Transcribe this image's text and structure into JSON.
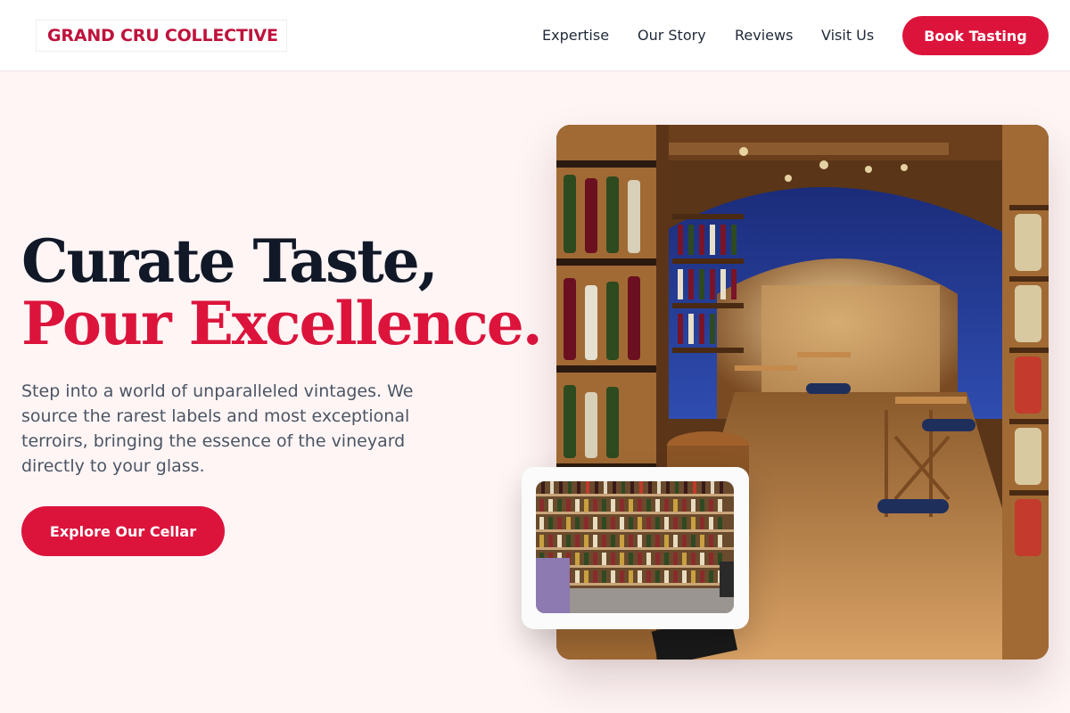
{
  "header": {
    "logo": "GRAND CRU COLLECTIVE",
    "nav": [
      "Expertise",
      "Our Story",
      "Reviews",
      "Visit Us"
    ],
    "book_button": "Book Tasting"
  },
  "hero": {
    "headline_line1": "Curate Taste,",
    "headline_line2": "Pour Excellence.",
    "description": "Step into a world of unparalleled vintages. We source the rarest labels and most exceptional terroirs, bringing the essence of the vineyard directly to your glass.",
    "cta_button": "Explore Our Cellar"
  },
  "colors": {
    "accent": "#dc143c",
    "background": "#fff5f5",
    "heading": "#111827",
    "body_text": "#4b5563"
  }
}
